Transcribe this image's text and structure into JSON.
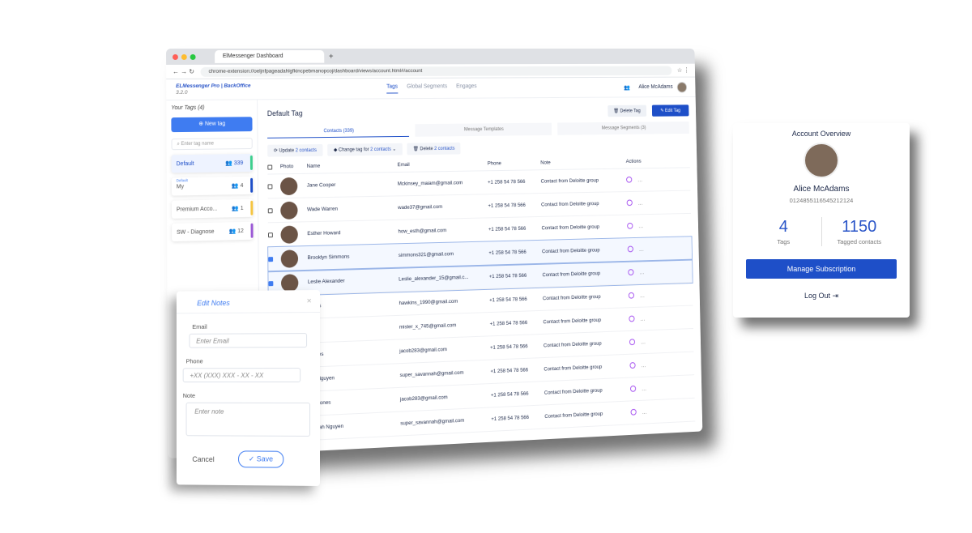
{
  "browser": {
    "tab_title": "ElMessenger Dashboard",
    "url": "chrome-extension://oeljnfpageadahlgfkincpebmanopcoj/dashboard/views/account.html#/account"
  },
  "app": {
    "brand": "ELMessenger Pro | BackOffice",
    "version": "3.2.0",
    "nav": [
      "Tags",
      "Global Segments",
      "Engages"
    ],
    "user_name": "Alice McAdams"
  },
  "sidebar": {
    "title": "Your Tags (4)",
    "new_tag": "New tag",
    "search_placeholder": "Enter tag name",
    "tags": [
      {
        "name": "Default",
        "count": "339",
        "color": "#3ecf8e"
      },
      {
        "name": "My",
        "count": "4",
        "sub": "Default",
        "color": "#1e4fc8"
      },
      {
        "name": "Premium Acco...",
        "count": "1",
        "color": "#f5c542"
      },
      {
        "name": "SW - Diagnose",
        "count": "12",
        "color": "#9b59d6"
      }
    ]
  },
  "main": {
    "title": "Default Tag",
    "delete_tag": "Delete Tag",
    "edit_tag": "Edit Tag",
    "subtabs": [
      "Contacts (339)",
      "Message Templates",
      "Message Segments (3)"
    ],
    "actions": {
      "update": "Update",
      "update_hl": "2 contacts",
      "change": "Change tag for",
      "change_hl": "2 contacts",
      "delete": "Delete",
      "delete_hl": "2 contacts"
    },
    "columns": [
      "Photo",
      "Name",
      "Email",
      "Phone",
      "Note",
      "Actions"
    ],
    "rows": [
      {
        "name": "Jane Cooper",
        "email": "Mckinsey_maiam@gmail.com",
        "phone": "+1 258 54 78 566",
        "note": "Contact from Deloitte group",
        "checked": false
      },
      {
        "name": "Wade Warren",
        "email": "wade37@gmail.com",
        "phone": "+1 258 54 78 566",
        "note": "Contact from Deloitte group",
        "checked": false
      },
      {
        "name": "Esther Howard",
        "email": "how_esth@gmail.com",
        "phone": "+1 258 54 78 566",
        "note": "Contact from Deloitte group",
        "checked": false
      },
      {
        "name": "Brooklyn Simmons",
        "email": "simmons321@gmail.com",
        "phone": "+1 258 54 78 566",
        "note": "Contact from Deloitte group",
        "checked": true
      },
      {
        "name": "Leslie Alexander",
        "email": "Leslie_alexander_15@gmail.c...",
        "phone": "+1 258 54 78 566",
        "note": "Contact from Deloitte group",
        "checked": true
      },
      {
        "name": "...kins",
        "email": "hawkins_1990@gmail.com",
        "phone": "+1 258 54 78 566",
        "note": "Contact from Deloitte group",
        "checked": false
      },
      {
        "name": "...ox",
        "email": "mister_x_745@gmail.com",
        "phone": "+1 258 54 78 566",
        "note": "Contact from Deloitte group",
        "checked": false
      },
      {
        "name": "...ones",
        "email": "jacob283@gmail.com",
        "phone": "+1 258 54 78 566",
        "note": "Contact from Deloitte group",
        "checked": false
      },
      {
        "name": "...h Nguyen",
        "email": "super_savannah@gmail.com",
        "phone": "+1 258 54 78 566",
        "note": "Contact from Deloitte group",
        "checked": false
      },
      {
        "name": "...b Jones",
        "email": "jacob283@gmail.com",
        "phone": "+1 258 54 78 566",
        "note": "Contact from Deloitte group",
        "checked": false
      },
      {
        "name": "...nnah Nguyen",
        "email": "super_savannah@gmail.com",
        "phone": "+1 258 54 78 566",
        "note": "Contact from Deloitte group",
        "checked": false
      }
    ]
  },
  "account": {
    "title": "Account Overview",
    "name": "Alice McAdams",
    "id": "0124855116545212124",
    "tags_count": "4",
    "tags_label": "Tags",
    "tagged_count": "1150",
    "tagged_label": "Tagged contacts",
    "manage": "Manage Subscription",
    "logout": "Log Out"
  },
  "notes": {
    "title": "Edit Notes",
    "email_label": "Email",
    "email_placeholder": "Enter Email",
    "phone_label": "Phone",
    "phone_placeholder": "+XX (XXX) XXX - XX - XX",
    "note_label": "Note",
    "note_placeholder": "Enter note",
    "cancel": "Cancel",
    "save": "Save"
  }
}
